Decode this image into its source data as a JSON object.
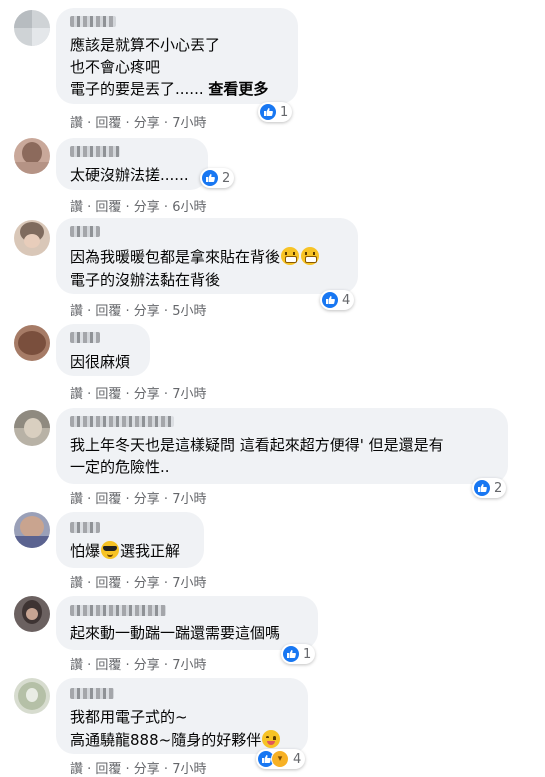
{
  "comments": [
    {
      "lines": [
        "應該是就算不小心丟了",
        "也不會心疼吧"
      ],
      "line3_text": "電子的要是丟了...... ",
      "see_more": "查看更多",
      "actions": "讚 · 回覆 · 分享 · 7小時",
      "reaction_count": "1"
    },
    {
      "lines": [
        "太硬沒辦法搓......"
      ],
      "actions": "讚 · 回覆 · 分享 · 6小時",
      "reaction_count": "2"
    },
    {
      "lines": [
        "因為我暖暖包都是拿來貼在背後",
        "電子的沒辦法黏在背後"
      ],
      "actions": "讚 · 回覆 · 分享 · 5小時",
      "reaction_count": "4",
      "emoji": "grinning-face"
    },
    {
      "lines": [
        "因很麻煩"
      ],
      "actions": "讚 · 回覆 · 分享 · 7小時"
    },
    {
      "lines": [
        "我上年冬天也是這樣疑問 這看起來超方便得' 但是還是有",
        "一定的危險性.."
      ],
      "actions": "讚 · 回覆 · 分享 · 7小時",
      "reaction_count": "2"
    },
    {
      "line_before_emoji": "怕爆",
      "line_after_emoji": "選我正解",
      "actions": "讚 · 回覆 · 分享 · 7小時",
      "emoji": "sunglasses-face"
    },
    {
      "lines": [
        "起來動一動踹一踹還需要這個嗎"
      ],
      "actions": "讚 · 回覆 · 分享 · 7小時",
      "reaction_count": "1"
    },
    {
      "lines": [
        "我都用電子式的~",
        "高通驍龍888~隨身的好夥伴"
      ],
      "actions": "讚 · 回覆 · 分享 · 7小時",
      "reaction_count": "4",
      "emoji": "yum-face",
      "reactions": [
        "like",
        "haha"
      ]
    }
  ],
  "colors": {
    "bubble": "#f0f2f5",
    "like": "#1877f2",
    "meta": "#65676b"
  }
}
